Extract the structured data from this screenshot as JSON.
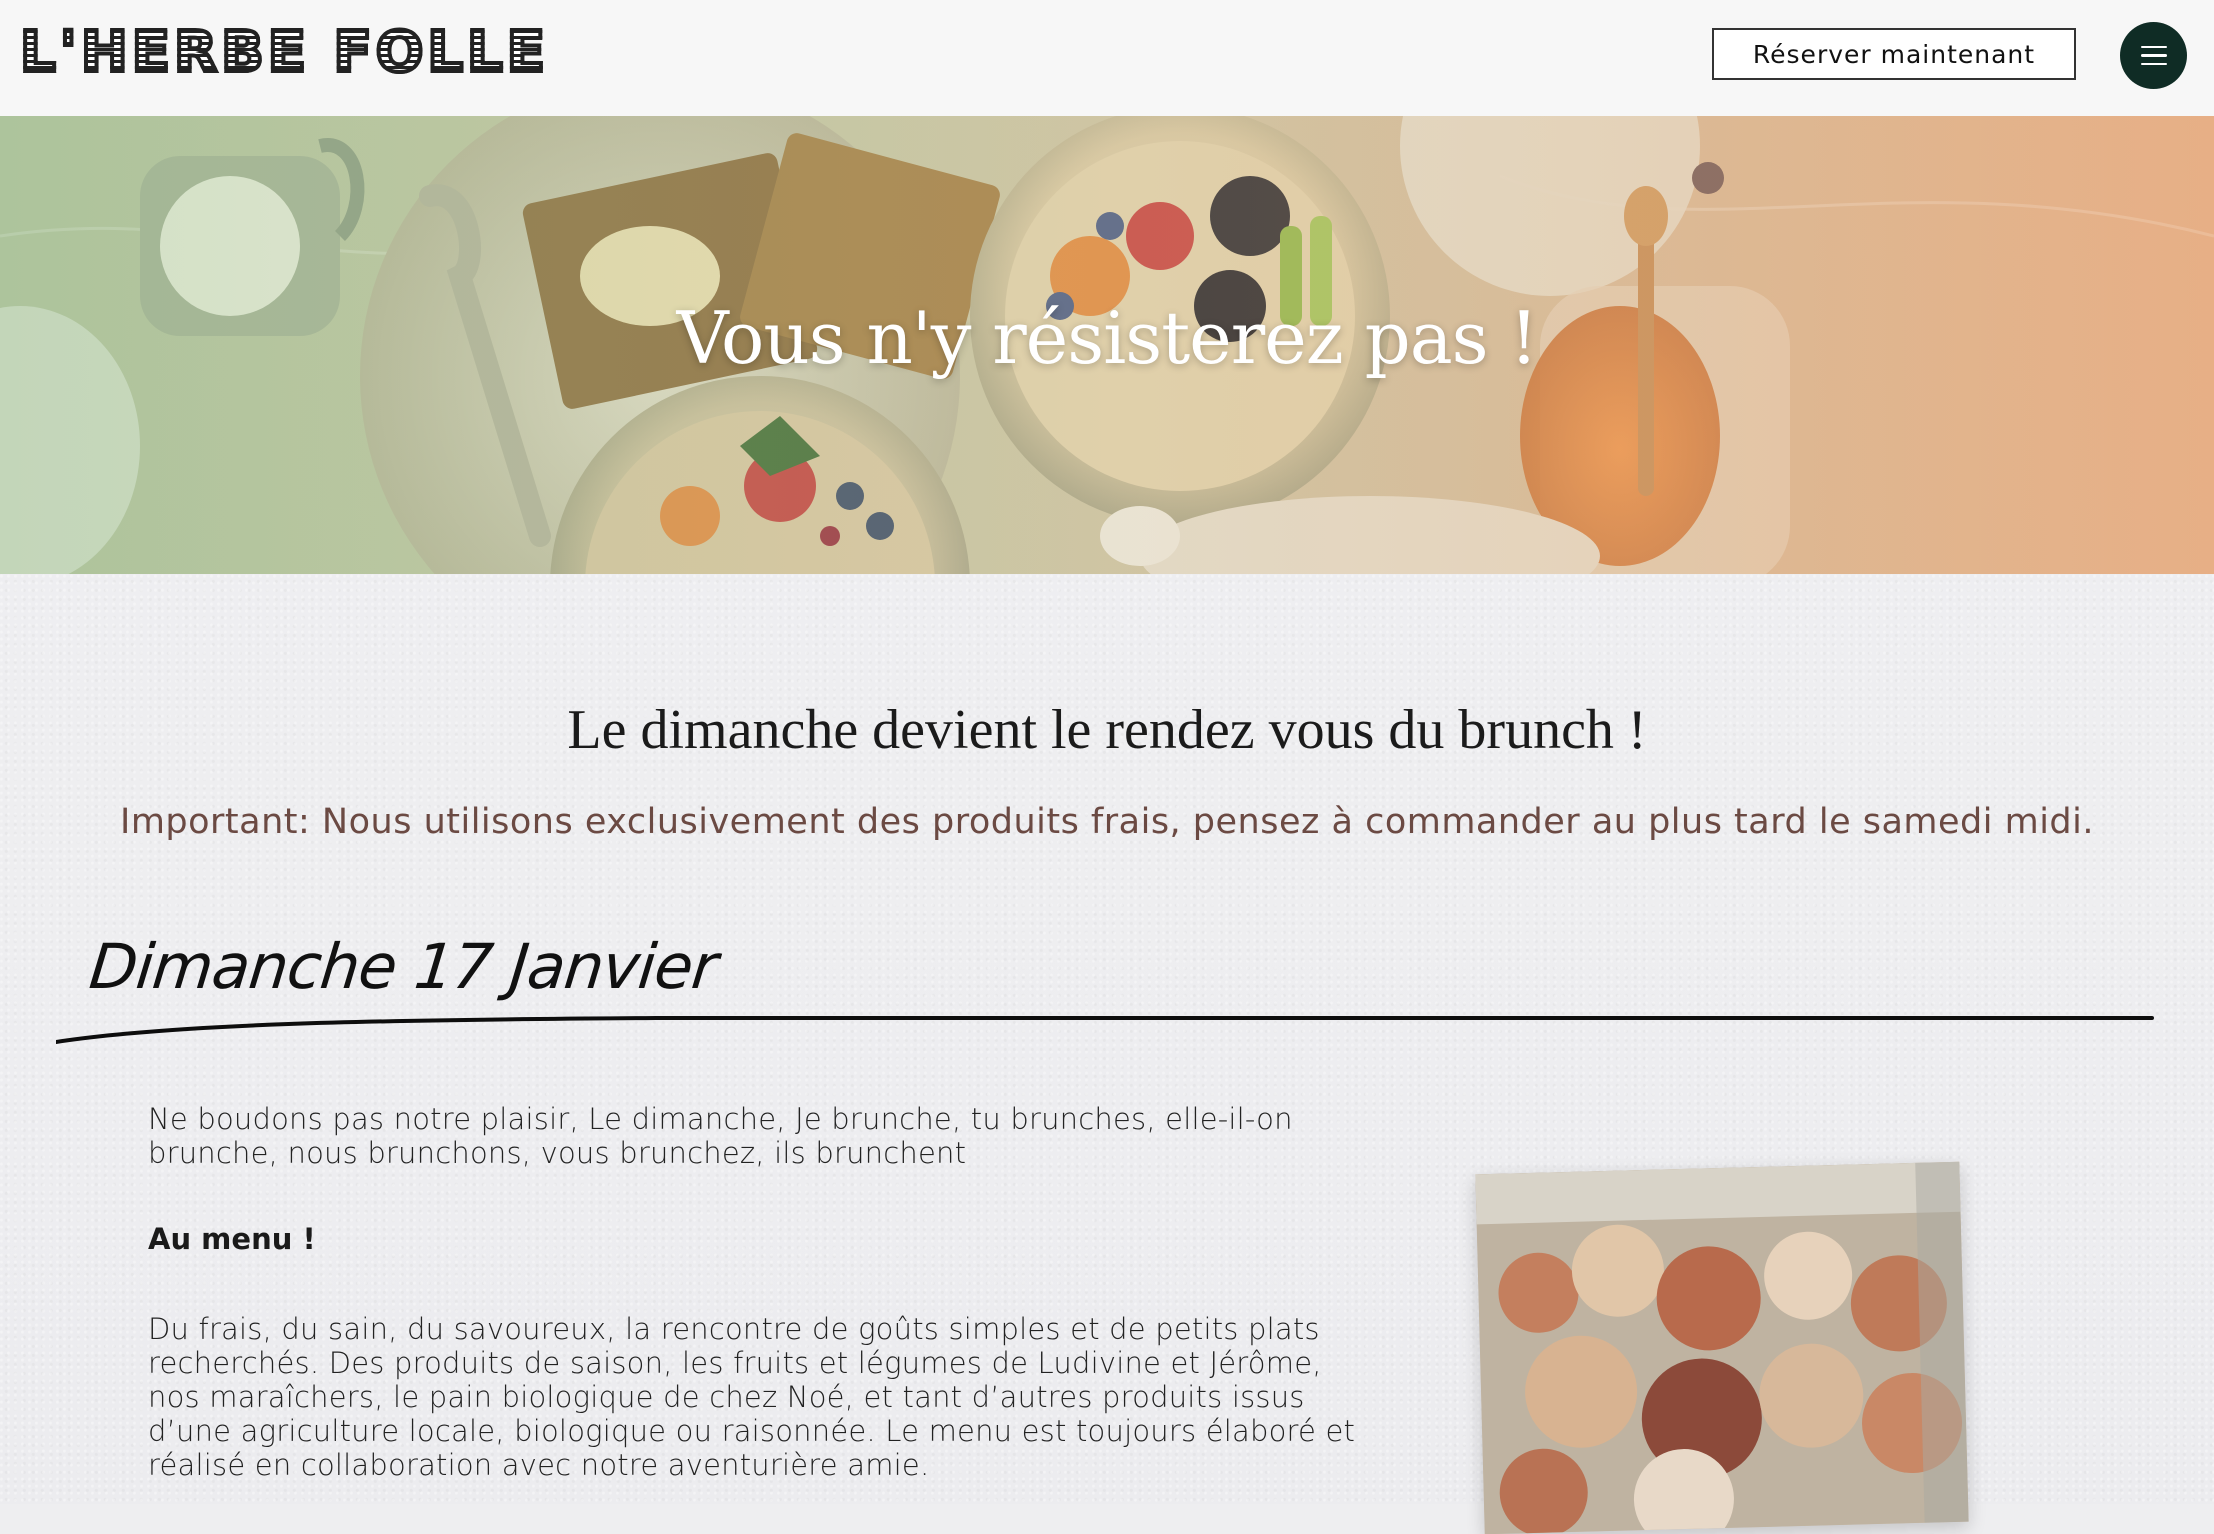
{
  "header": {
    "logo_text": "L'HERBE FOLLE",
    "reserve_label": "Réserver maintenant",
    "menu_icon": "hamburger-menu-icon"
  },
  "hero": {
    "title": "Vous n'y résisterez pas !"
  },
  "content": {
    "intro_title": "Le dimanche devient le rendez vous du brunch !",
    "important_note": "Important: Nous utilisons exclusivement des produits frais, pensez à commander au plus tard le samedi midi.",
    "date_heading": "Dimanche 17 Janvier",
    "paragraph_1": "Ne boudons pas notre plaisir, Le dimanche, Je brunche, tu brunches, elle-il-on brunche, nous brunchons, vous brunchez, ils brunchent",
    "menu_heading": "Au menu !",
    "paragraph_2": "Du frais, du sain, du savoureux, la rencontre de goûts simples et de petits plats recherchés. Des produits de saison, les fruits et légumes de Ludivine et Jérôme, nos maraîchers, le pain biologique de chez Noé, et tant d’autres produits issus d’une agriculture locale, biologique ou raisonnée. Le menu est toujours élaboré et réalisé en collaboration avec notre aventurière amie."
  },
  "colors": {
    "header_bg": "#f7f7f7",
    "menu_button_bg": "#0f2c25",
    "important_text": "#6b4a43",
    "page_bg": "#eeeef0"
  }
}
